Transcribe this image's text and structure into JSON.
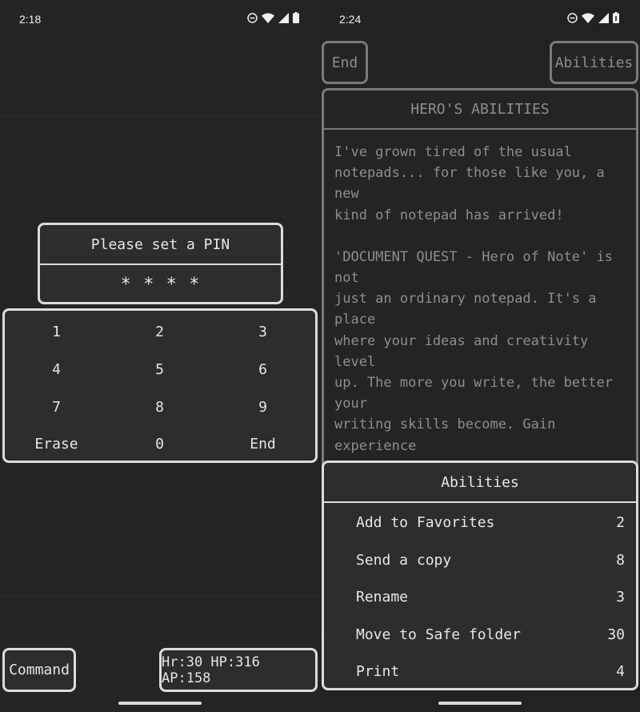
{
  "left": {
    "status": {
      "time": "2:18"
    },
    "pin_dialog": {
      "title": "Please set a PIN",
      "value": "* * * *"
    },
    "keypad": {
      "keys": [
        "1",
        "2",
        "3",
        "4",
        "5",
        "6",
        "7",
        "8",
        "9",
        "Erase",
        "0",
        "End"
      ]
    },
    "command_button": "Command",
    "stats": "Hr:30 HP:316 AP:158"
  },
  "right": {
    "status": {
      "time": "2:24"
    },
    "end_button": "End",
    "abilities_button": "Abilities",
    "panel_title": "HERO'S ABILITIES",
    "paragraph1": "I've grown tired of the usual\nnotepads... for those like you, a new\nkind of notepad has arrived!",
    "paragraph2": "'DOCUMENT QUEST - Hero of Note' is not\njust an ordinary notepad. It's a place\nwhere your ideas and creativity level\nup. The more you write, the better your\nwriting skills become. Gain experience\npoints, level up, and unlock new\nfeatures and customization options. But\nbe cautious, neglecting your writing\nwill decrease your HP. If you slack\noff, your creative adventure might come\nto a halt.",
    "menu": {
      "title": "Abilities",
      "items": [
        {
          "label": "Add to Favorites",
          "cost": "2"
        },
        {
          "label": "Send a copy",
          "cost": "8"
        },
        {
          "label": "Rename",
          "cost": "3"
        },
        {
          "label": "Move to Safe folder",
          "cost": "30"
        },
        {
          "label": "Print",
          "cost": "4"
        }
      ]
    }
  },
  "colors": {
    "border": "#dcdcdc",
    "dim_border": "#7a7a7a",
    "panel": "#2d2d2d",
    "text": "#e6e6e6",
    "dim_text": "#8e8e8e"
  },
  "icons": [
    "dnd-icon",
    "wifi-icon",
    "signal-icon",
    "battery-icon"
  ]
}
